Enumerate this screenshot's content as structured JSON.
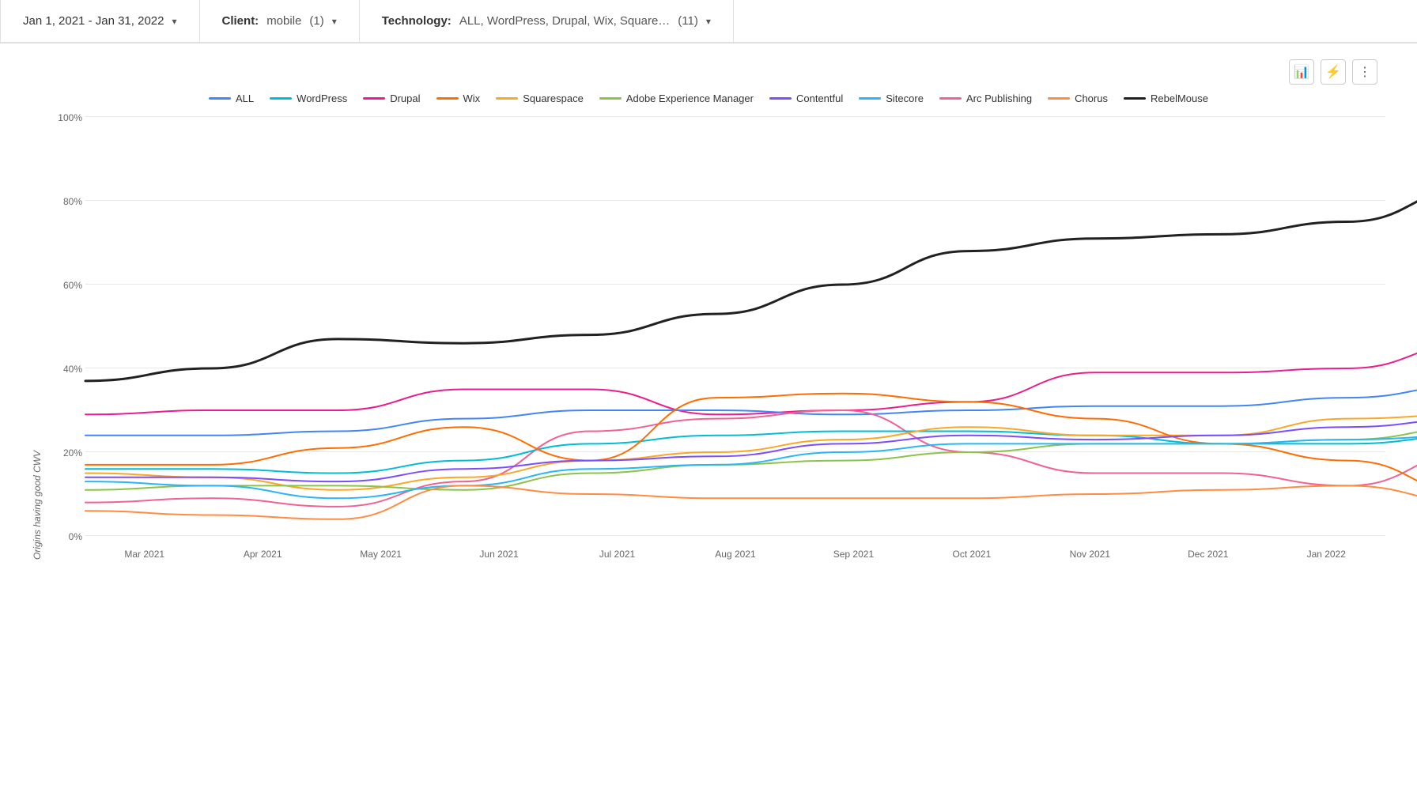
{
  "filters": {
    "date": {
      "label": "Jan 1, 2021 - Jan 31, 2022"
    },
    "client": {
      "label": "Client",
      "value": "mobile",
      "count": "(1)"
    },
    "technology": {
      "label": "Technology",
      "value": "ALL, WordPress, Drupal, Wix, Square…",
      "count": "(11)"
    }
  },
  "toolbar": {
    "chart_icon": "⊞",
    "bolt_icon": "⚡",
    "more_icon": "⋮"
  },
  "yaxis_label": "Origins having good CWV",
  "y_ticks": [
    "0%",
    "20%",
    "40%",
    "60%",
    "80%",
    "100%"
  ],
  "x_ticks": [
    "Mar 2021",
    "Apr 2021",
    "May 2021",
    "Jun 2021",
    "Jul 2021",
    "Aug 2021",
    "Sep 2021",
    "Oct 2021",
    "Nov 2021",
    "Dec 2021",
    "Jan 2022"
  ],
  "legend": [
    {
      "label": "ALL",
      "color": "#4285f4"
    },
    {
      "label": "WordPress",
      "color": "#00bcd4"
    },
    {
      "label": "Drupal",
      "color": "#e91e8c"
    },
    {
      "label": "Wix",
      "color": "#ff6d00"
    },
    {
      "label": "Squarespace",
      "color": "#f9a825"
    },
    {
      "label": "Adobe Experience Manager",
      "color": "#8bc34a"
    },
    {
      "label": "Contentful",
      "color": "#7c4dff"
    },
    {
      "label": "Sitecore",
      "color": "#29b6f6"
    },
    {
      "label": "Arc Publishing",
      "color": "#f06292"
    },
    {
      "label": "Chorus",
      "color": "#ff8c42"
    },
    {
      "label": "RebelMouse",
      "color": "#212121"
    }
  ],
  "series": {
    "RebelMouse": {
      "color": "#212121",
      "width": 3,
      "points": [
        37,
        40,
        47,
        46,
        48,
        53,
        60,
        68,
        71,
        72,
        75,
        83
      ]
    },
    "Drupal": {
      "color": "#e91e8c",
      "width": 2,
      "points": [
        29,
        30,
        30,
        35,
        35,
        29,
        30,
        32,
        39,
        39,
        40,
        46
      ]
    },
    "ALL": {
      "color": "#4285f4",
      "width": 2,
      "points": [
        24,
        24,
        25,
        28,
        30,
        30,
        29,
        30,
        31,
        31,
        33,
        36
      ]
    },
    "ArcPublishing": {
      "color": "#f06292",
      "width": 2,
      "points": [
        8,
        9,
        7,
        13,
        25,
        28,
        30,
        20,
        15,
        15,
        12,
        20
      ]
    },
    "WordPress": {
      "color": "#00bcd4",
      "width": 2,
      "points": [
        16,
        16,
        15,
        18,
        22,
        24,
        25,
        25,
        24,
        22,
        22,
        24
      ]
    },
    "Squarespace": {
      "color": "#f9a825",
      "width": 2,
      "points": [
        15,
        14,
        11,
        14,
        18,
        20,
        23,
        26,
        24,
        24,
        28,
        29
      ]
    },
    "Wix": {
      "color": "#ff6d00",
      "width": 2,
      "points": [
        17,
        17,
        21,
        26,
        18,
        33,
        34,
        32,
        28,
        22,
        18,
        10
      ]
    },
    "AdobeEM": {
      "color": "#8bc34a",
      "width": 2,
      "points": [
        11,
        12,
        12,
        11,
        15,
        17,
        18,
        20,
        22,
        22,
        23,
        26
      ]
    },
    "Contentful": {
      "color": "#7c4dff",
      "width": 2,
      "points": [
        14,
        14,
        13,
        16,
        18,
        19,
        22,
        24,
        23,
        24,
        26,
        28
      ]
    },
    "Sitecore": {
      "color": "#29b6f6",
      "width": 2,
      "points": [
        13,
        12,
        9,
        12,
        16,
        17,
        20,
        22,
        22,
        22,
        23,
        24
      ]
    },
    "Chorus": {
      "color": "#ff8c42",
      "width": 2,
      "points": [
        6,
        5,
        4,
        12,
        10,
        9,
        9,
        9,
        10,
        11,
        12,
        8
      ]
    }
  }
}
